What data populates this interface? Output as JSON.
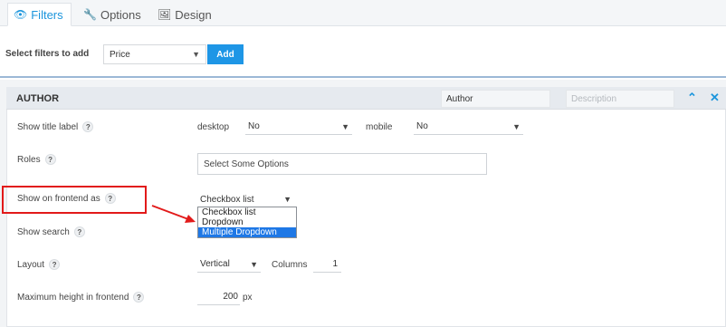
{
  "tabs": [
    {
      "label": "Filters",
      "icon": "eye-icon",
      "active": true
    },
    {
      "label": "Options",
      "icon": "wrench-icon",
      "active": false
    },
    {
      "label": "Design",
      "icon": "image-icon",
      "active": false
    }
  ],
  "filterbar": {
    "label": "Select filters to add",
    "select_value": "Price",
    "add_label": "Add"
  },
  "panel": {
    "title": "AUTHOR",
    "title_input_value": "Author",
    "description_placeholder": "Description",
    "collapse_icon": "chevron-up-icon",
    "close_icon": "close-icon",
    "accent_color": "#1b95dc"
  },
  "rows": {
    "show_title": {
      "label": "Show title label",
      "desktop_label": "desktop",
      "desktop_value": "No",
      "mobile_label": "mobile",
      "mobile_value": "No"
    },
    "roles": {
      "label": "Roles",
      "placeholder": "Select Some Options"
    },
    "frontend": {
      "label": "Show on frontend as",
      "value": "Checkbox list",
      "options": [
        "Checkbox list",
        "Dropdown",
        "Multiple Dropdown"
      ],
      "highlighted_option": "Multiple Dropdown"
    },
    "search": {
      "label": "Show search"
    },
    "layout": {
      "label": "Layout",
      "value": "Vertical",
      "columns_label": "Columns",
      "columns_value": "1"
    },
    "max_height": {
      "label": "Maximum height in frontend",
      "value": "200",
      "unit": "px"
    }
  },
  "help_glyph": "?",
  "annotation": {
    "highlight_color": "#e21a1a"
  }
}
